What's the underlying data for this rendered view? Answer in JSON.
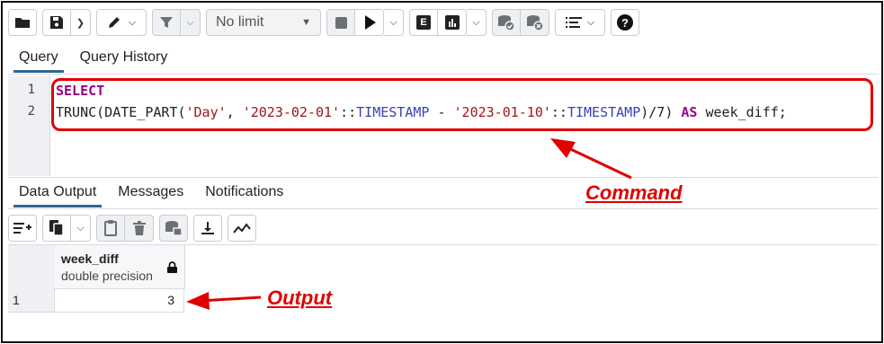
{
  "toolbar": {
    "limit_value": "No limit",
    "icons": [
      "folder-icon",
      "save-icon",
      "chevron-down-icon",
      "edit-icon",
      "filter-icon",
      "stop-icon",
      "play-icon",
      "explain-icon",
      "explain-analyze-icon",
      "commit-icon",
      "rollback-icon",
      "macros-icon",
      "help-icon"
    ]
  },
  "editor_tabs": [
    "Query",
    "Query History"
  ],
  "editor": {
    "lines": [
      "1",
      "2"
    ],
    "line1_keyword": "SELECT",
    "line2": {
      "fn1": "TRUNC(DATE_PART(",
      "s1": "'Day'",
      "sep1": ", ",
      "s2": "'2023-02-01'",
      "cast1": "::",
      "t1": "TIMESTAMP",
      "minus": " - ",
      "s3": "'2023-01-10'",
      "cast2": "::",
      "t2": "TIMESTAMP",
      "tail": ")/7) ",
      "as": "AS",
      "alias": " week_diff;"
    }
  },
  "output_tabs": [
    "Data Output",
    "Messages",
    "Notifications"
  ],
  "result": {
    "columns": [
      {
        "name": "week_diff",
        "type": "double precision"
      }
    ],
    "rows": [
      {
        "num": "1",
        "values": [
          "3"
        ]
      }
    ]
  },
  "annotations": {
    "command": "Command",
    "output": "Output"
  },
  "colors": {
    "highlight": "#e00000",
    "tab_underline": "#326690",
    "keyword": "#990088",
    "string": "#a31515",
    "type": "#3b3fb6"
  }
}
